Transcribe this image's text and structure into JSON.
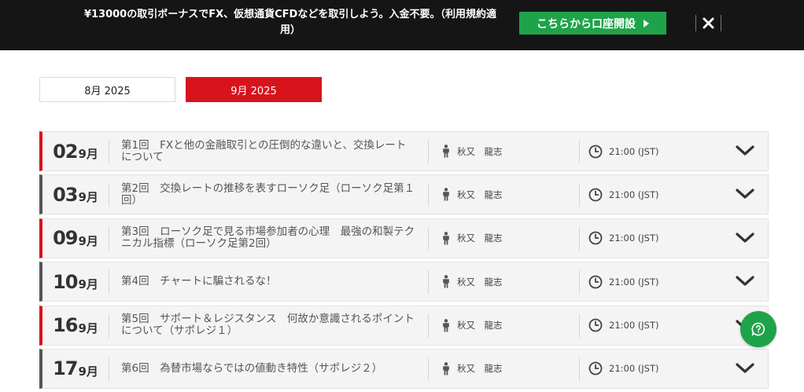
{
  "banner": {
    "text": "¥13000の取引ボーナスでFX、仮想通貨CFDなどを取引しよう。入金不要。（利用規約適用）",
    "cta_label": "こちらから口座開設"
  },
  "month_tabs": [
    {
      "label": "8月 2025",
      "active": false
    },
    {
      "label": "9月 2025",
      "active": true
    }
  ],
  "seminars": [
    {
      "day": "02",
      "month": "9月",
      "title": "第1回　FXと他の金融取引との圧倒的な違いと、交換レートについて",
      "lecturer": "秋又　龍志",
      "time": "21:00 (JST)",
      "marker": "red"
    },
    {
      "day": "03",
      "month": "9月",
      "title": "第2回　交換レートの推移を表すローソク足（ローソク足第１回）",
      "lecturer": "秋又　龍志",
      "time": "21:00 (JST)",
      "marker": "gray"
    },
    {
      "day": "09",
      "month": "9月",
      "title": "第3回　ローソク足で見る市場参加者の心理　最強の和製テクニカル指標（ローソク足第2回）",
      "lecturer": "秋又　龍志",
      "time": "21:00 (JST)",
      "marker": "red"
    },
    {
      "day": "10",
      "month": "9月",
      "title": "第4回　チャートに騙されるな！",
      "lecturer": "秋又　龍志",
      "time": "21:00 (JST)",
      "marker": "gray"
    },
    {
      "day": "16",
      "month": "9月",
      "title": "第5回　サポート＆レジスタンス　何故か意識されるポイントについて（サポレジ１）",
      "lecturer": "秋又　龍志",
      "time": "21:00 (JST)",
      "marker": "red"
    },
    {
      "day": "17",
      "month": "9月",
      "title": "第6回　為替市場ならではの値動き特性（サポレジ２）",
      "lecturer": "秋又　龍志",
      "time": "21:00 (JST)",
      "marker": "gray"
    }
  ],
  "icons": {
    "lecturer": "person-icon",
    "time": "clock-icon",
    "expand": "chevron-down-icon",
    "close": "close-icon",
    "chat": "help-chat-icon"
  },
  "colors": {
    "banner_bg": "#151515",
    "accent_green": "#1fa34a",
    "accent_red": "#d7141c"
  }
}
